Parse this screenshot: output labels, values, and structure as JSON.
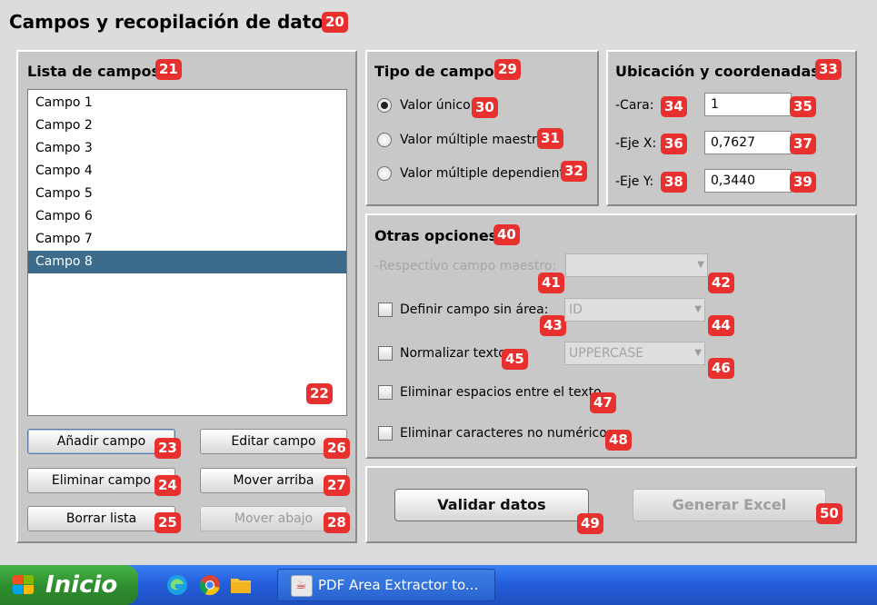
{
  "header": {
    "title": "Campos y recopilación de datos"
  },
  "badges": {
    "b20": "20",
    "b21": "21",
    "b22": "22",
    "b23": "23",
    "b24": "24",
    "b25": "25",
    "b26": "26",
    "b27": "27",
    "b28": "28",
    "b29": "29",
    "b30": "30",
    "b31": "31",
    "b32": "32",
    "b33": "33",
    "b34": "34",
    "b35": "35",
    "b36": "36",
    "b37": "37",
    "b38": "38",
    "b39": "39",
    "b40": "40",
    "b41": "41",
    "b42": "42",
    "b43": "43",
    "b44": "44",
    "b45": "45",
    "b46": "46",
    "b47": "47",
    "b48": "48",
    "b49": "49",
    "b50": "50"
  },
  "list_panel": {
    "title": "Lista de campos",
    "items": [
      "Campo 1",
      "Campo 2",
      "Campo 3",
      "Campo 4",
      "Campo 5",
      "Campo 6",
      "Campo 7",
      "Campo 8"
    ],
    "selected_index": 7,
    "buttons": {
      "add": "Añadir campo",
      "edit": "Editar campo",
      "delete": "Eliminar campo",
      "move_up": "Mover arriba",
      "clear": "Borrar lista",
      "move_down": "Mover abajo"
    }
  },
  "field_type": {
    "title": "Tipo de campo",
    "options": [
      "Valor único",
      "Valor múltiple maestro",
      "Valor múltiple dependiente"
    ],
    "selected_index": 0
  },
  "location": {
    "title": "Ubicación y coordenadas",
    "face_label": "-Cara:",
    "face_value": "1",
    "x_label": "-Eje X:",
    "x_value": "0,7627",
    "y_label": "-Eje Y:",
    "y_value": "0,3440"
  },
  "other": {
    "title": "Otras opciones",
    "master_label": "-Respectivo campo maestro:",
    "master_value": "",
    "no_area_label": "Definir campo sin área:",
    "no_area_value": "ID",
    "normalize_label": "Normalizar texto:",
    "normalize_value": "UPPERCASE",
    "remove_spaces_label": "Eliminar espacios entre el texto",
    "remove_non_numeric_label": "Eliminar caracteres no numéricos"
  },
  "actions": {
    "validate": "Validar datos",
    "excel": "Generar Excel"
  },
  "taskbar": {
    "start": "Inicio",
    "task": "PDF Area Extractor to..."
  },
  "colors": {
    "badge": "#e8312e",
    "selection": "#3d6b8c",
    "taskbar": "#245edb",
    "start": "#2f8f2f"
  }
}
